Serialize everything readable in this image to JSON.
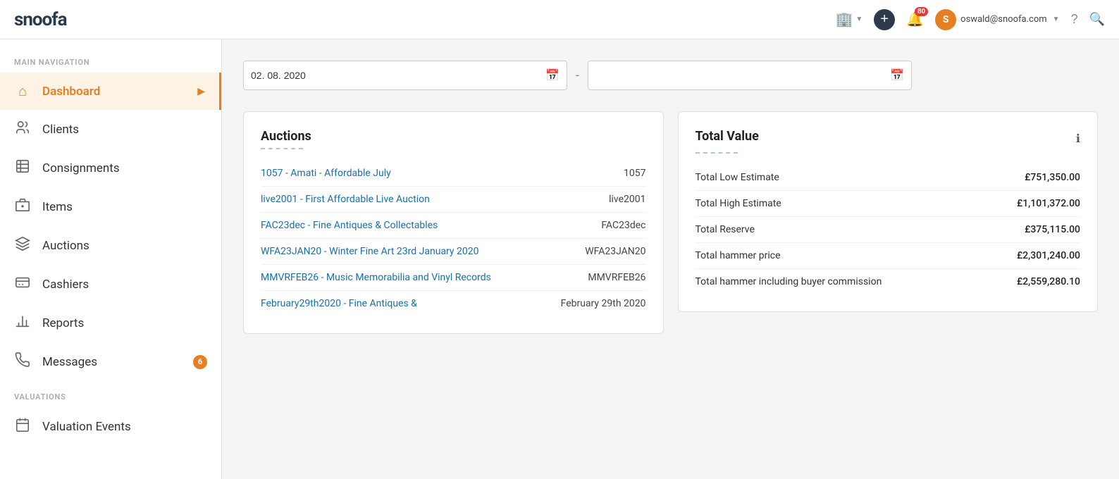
{
  "header": {
    "logo": "snoofa",
    "user_email": "oswald@snoofa.com",
    "user_initial": "S",
    "notification_count": "80"
  },
  "sidebar": {
    "section_label": "MAIN NAVIGATION",
    "items": [
      {
        "id": "dashboard",
        "label": "Dashboard",
        "icon": "home",
        "active": true
      },
      {
        "id": "clients",
        "label": "Clients",
        "icon": "people"
      },
      {
        "id": "consignments",
        "label": "Consignments",
        "icon": "list"
      },
      {
        "id": "items",
        "label": "Items",
        "icon": "garage"
      },
      {
        "id": "auctions",
        "label": "Auctions",
        "icon": "gavel"
      },
      {
        "id": "cashiers",
        "label": "Cashiers",
        "icon": "cashier"
      },
      {
        "id": "reports",
        "label": "Reports",
        "icon": "chart"
      },
      {
        "id": "messages",
        "label": "Messages",
        "icon": "message",
        "badge": "6"
      }
    ],
    "valuation_label": "VALUATIONS",
    "valuation_items": [
      {
        "id": "valuation-events",
        "label": "Valuation Events",
        "icon": "calendar"
      }
    ]
  },
  "date_range": {
    "start_date": "02. 08. 2020",
    "end_date": "",
    "separator": "-",
    "start_placeholder": "",
    "end_placeholder": ""
  },
  "auctions_card": {
    "title": "Auctions",
    "items": [
      {
        "name": "1057 - Amati - Affordable July",
        "code": "1057"
      },
      {
        "name": "live2001 - First Affordable Live Auction",
        "code": "live2001"
      },
      {
        "name": "FAC23dec - Fine Antiques & Collectables",
        "code": "FAC23dec"
      },
      {
        "name": "WFA23JAN20 - Winter Fine Art 23rd January 2020",
        "code": "WFA23JAN20"
      },
      {
        "name": "MMVRFEB26 - Music Memorabilia and Vinyl Records",
        "code": "MMVRFEB26"
      },
      {
        "name": "February29th2020 - Fine Antiques &",
        "code": "February 29th 2020"
      }
    ]
  },
  "total_value_card": {
    "title": "Total Value",
    "rows": [
      {
        "label": "Total Low Estimate",
        "value": "£751,350.00"
      },
      {
        "label": "Total High Estimate",
        "value": "£1,101,372.00"
      },
      {
        "label": "Total Reserve",
        "value": "£375,115.00"
      },
      {
        "label": "Total hammer price",
        "value": "£2,301,240.00"
      },
      {
        "label": "Total hammer including buyer commission",
        "value": "£2,559,280.10"
      }
    ]
  }
}
